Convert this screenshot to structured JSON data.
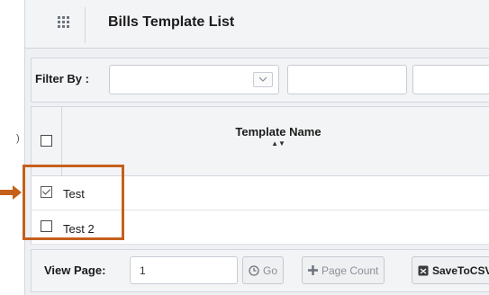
{
  "header": {
    "title": "Bills Template List",
    "icon": "grid-icon"
  },
  "filter": {
    "label": "Filter By :",
    "select_value": "",
    "input1_value": "",
    "input2_value": ""
  },
  "table": {
    "columns": [
      {
        "label": "Template Name",
        "sort": "▲▼"
      }
    ],
    "rows": [
      {
        "name": "Test",
        "checked": true
      },
      {
        "name": "Test 2",
        "checked": false
      }
    ]
  },
  "pager": {
    "label": "View Page:",
    "page_value": "1",
    "go_label": "Go",
    "page_count_label": "Page Count",
    "csv_label": "SaveToCSV"
  },
  "annotation": {
    "color": "#c5601b"
  },
  "side_glyph": ")"
}
